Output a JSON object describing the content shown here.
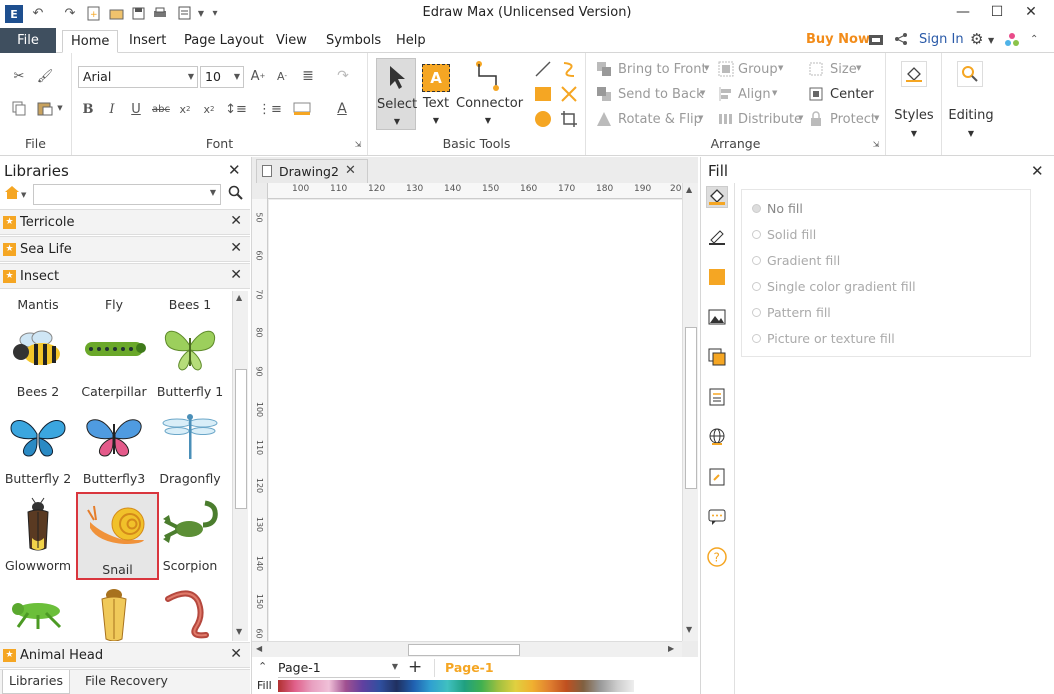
{
  "window": {
    "title": "Edraw Max (Unlicensed Version)"
  },
  "menu": {
    "file": "File",
    "tabs": [
      "Home",
      "Insert",
      "Page Layout",
      "View",
      "Symbols",
      "Help"
    ],
    "buy_now": "Buy Now",
    "sign_in": "Sign In"
  },
  "ribbon": {
    "file_group": "File",
    "font": {
      "family": "Arial",
      "size": "10",
      "label": "Font"
    },
    "basic_tools": {
      "select": "Select",
      "text": "Text",
      "connector": "Connector",
      "label": "Basic Tools"
    },
    "arrange": {
      "bring_to_front": "Bring to Front",
      "send_to_back": "Send to Back",
      "rotate_flip": "Rotate & Flip",
      "group": "Group",
      "align": "Align",
      "distribute": "Distribute",
      "size": "Size",
      "center": "Center",
      "protect": "Protect",
      "label": "Arrange"
    },
    "styles": "Styles",
    "editing": "Editing"
  },
  "libraries": {
    "title": "Libraries",
    "search_placeholder": "",
    "categories": [
      "Terricole",
      "Sea Life",
      "Insect"
    ],
    "shapes_row0": [
      "Mantis",
      "Fly",
      "Bees 1"
    ],
    "shapes_row1": [
      "Bees 2",
      "Caterpillar",
      "Butterfly 1"
    ],
    "shapes_row2": [
      "Butterfly 2",
      "Butterfly3",
      "Dragonfly"
    ],
    "shapes_row3": [
      "Glowworm",
      "Snail",
      "Scorpion"
    ],
    "bottom_category": "Animal Head",
    "tabs": [
      "Libraries",
      "File Recovery"
    ]
  },
  "document": {
    "tab": "Drawing2",
    "ruler_top": [
      "100",
      "110",
      "120",
      "130",
      "140",
      "150",
      "160",
      "170",
      "180",
      "190",
      "20"
    ],
    "ruler_left": [
      "50",
      "60",
      "70",
      "80",
      "90",
      "100",
      "110",
      "120",
      "130",
      "140",
      "150",
      "60"
    ]
  },
  "pages": {
    "selector": "Page-1",
    "active": "Page-1",
    "fill_label": "Fill"
  },
  "fill_panel": {
    "title": "Fill",
    "options": [
      "No fill",
      "Solid fill",
      "Gradient fill",
      "Single color gradient fill",
      "Pattern fill",
      "Picture or texture fill"
    ]
  },
  "colors": {
    "accent": "#f5a623",
    "file_tab": "#3f4f5f",
    "selection": "#d9363e"
  }
}
